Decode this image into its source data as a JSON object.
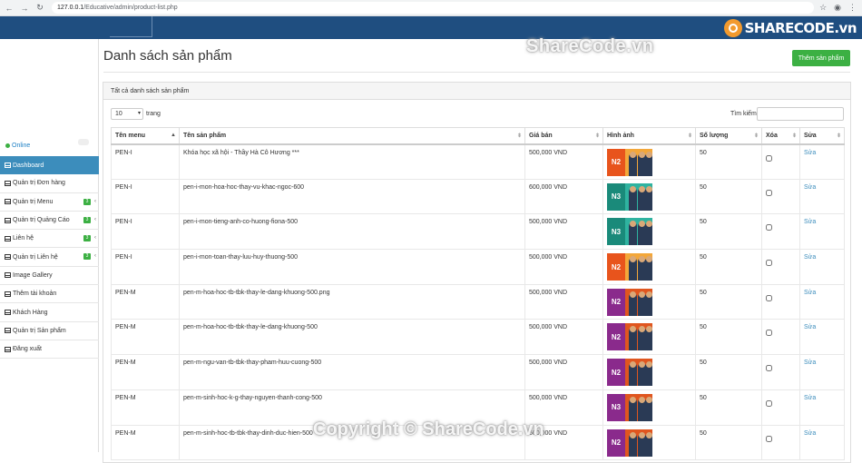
{
  "browser": {
    "url_host": "127.0.0.1",
    "url_path": "/Educative/admin/product-list.php"
  },
  "logo": {
    "text_share": "SHARE",
    "text_code": "CODE",
    "text_vn": ".vn"
  },
  "sidebar": {
    "online_label": "Online",
    "items": [
      {
        "label": "Dashboard",
        "active": true,
        "badge": ""
      },
      {
        "label": "Quản trị Đơn hàng",
        "badge": ""
      },
      {
        "label": "Quản trị Menu",
        "badge": "3"
      },
      {
        "label": "Quản trị Quảng Cáo",
        "badge": "3"
      },
      {
        "label": "Liên hệ",
        "badge": "3"
      },
      {
        "label": "Quản trị Liên hệ",
        "badge": "3"
      },
      {
        "label": "Image Gallery",
        "badge": ""
      },
      {
        "label": "Thêm tài khoản",
        "badge": ""
      },
      {
        "label": "Khách Hàng",
        "badge": ""
      },
      {
        "label": "Quản trị Sản phẩm",
        "badge": ""
      },
      {
        "label": "Đăng xuất",
        "badge": ""
      }
    ]
  },
  "main": {
    "title": "Danh sách sản phẩm",
    "add_button": "Thêm sản phẩm",
    "panel_title": "Tất cả danh sách sản phẩm",
    "length_value": "10",
    "length_label": "trang",
    "search_label": "Tìm kiếm:",
    "columns": [
      "Tên menu",
      "Tên sản phẩm",
      "Giá bán",
      "Hình ảnh",
      "Số lượng",
      "Xóa",
      "Sửa"
    ],
    "edit_label": "Sửa",
    "rows": [
      {
        "menu": "PEN-I",
        "name": "Khóa học xã hội - Thầy Hà Cô Hương ***",
        "price": "500,000 VND",
        "tag": "N2",
        "tag_color": "#e8541c",
        "bg": "#f3a73a",
        "qty": "50"
      },
      {
        "menu": "PEN-I",
        "name": "pen-i-mon-hoa-hoc-thay-vu-khac-ngoc-600",
        "price": "600,000 VND",
        "tag": "N3",
        "tag_color": "#1a8a7a",
        "bg": "#2fb3a0",
        "qty": "50"
      },
      {
        "menu": "PEN-I",
        "name": "pen-i-mon-tieng-anh-co-huong-fiona-500",
        "price": "500,000 VND",
        "tag": "N3",
        "tag_color": "#1a8a7a",
        "bg": "#2fb3a0",
        "qty": "50"
      },
      {
        "menu": "PEN-I",
        "name": "pen-i-mon-toan-thay-luu-huy-thuong-500",
        "price": "500,000 VND",
        "tag": "N2",
        "tag_color": "#e8541c",
        "bg": "#f3a73a",
        "qty": "50"
      },
      {
        "menu": "PEN-M",
        "name": "pen-m-hoa-hoc-tb-tbk-thay-le-dang-khuong-500.png",
        "price": "500,000 VND",
        "tag": "N2",
        "tag_color": "#8a2a8c",
        "bg": "#e0561f",
        "qty": "50"
      },
      {
        "menu": "PEN-M",
        "name": "pen-m-hoa-hoc-tb-tbk-thay-le-dang-khuong-500",
        "price": "500,000 VND",
        "tag": "N2",
        "tag_color": "#8a2a8c",
        "bg": "#e0561f",
        "qty": "50"
      },
      {
        "menu": "PEN-M",
        "name": "pen-m-ngu-van-tb-tbk-thay-pham-huu-cuong-500",
        "price": "500,000 VND",
        "tag": "N2",
        "tag_color": "#8a2a8c",
        "bg": "#e0561f",
        "qty": "50"
      },
      {
        "menu": "PEN-M",
        "name": "pen-m-sinh-hoc-k-g-thay-nguyen-thanh-cong-500",
        "price": "500,000 VND",
        "tag": "N3",
        "tag_color": "#8a2a8c",
        "bg": "#e0561f",
        "qty": "50"
      },
      {
        "menu": "PEN-M",
        "name": "pen-m-sinh-hoc-tb-tbk-thay-dinh-duc-hien-500",
        "price": "500,000 VND",
        "tag": "N2",
        "tag_color": "#8a2a8c",
        "bg": "#e0561f",
        "qty": "50"
      }
    ]
  },
  "watermark": {
    "top": "ShareCode.vn",
    "bottom": "Copyright © ShareCode.vn"
  }
}
